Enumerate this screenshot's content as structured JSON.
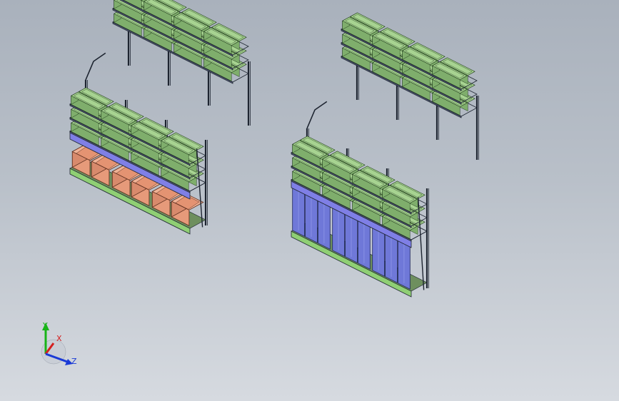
{
  "triad": {
    "x_label": "X",
    "y_label": "Y",
    "z_label": "Z",
    "x_color": "#d42020",
    "y_color": "#18b418",
    "z_color": "#1a3ad6"
  },
  "colors": {
    "frame": "#1d2430",
    "deck": "#7f7fe6",
    "bin_top": "#a7d391",
    "bin_side": "#7fae6c",
    "bin_edge": "#1f3a1a",
    "crate": "#e69a7a",
    "crate_edge": "#5a2c1c",
    "panel": "#6f78d8",
    "panel_edge": "#1d235e",
    "base_strip": "#8fcf74"
  },
  "scene": {
    "left_rack_bays": 3,
    "right_rack_bays": 3,
    "bin_icon": "storage-bin",
    "crate_icon": "cardboard-crate"
  }
}
